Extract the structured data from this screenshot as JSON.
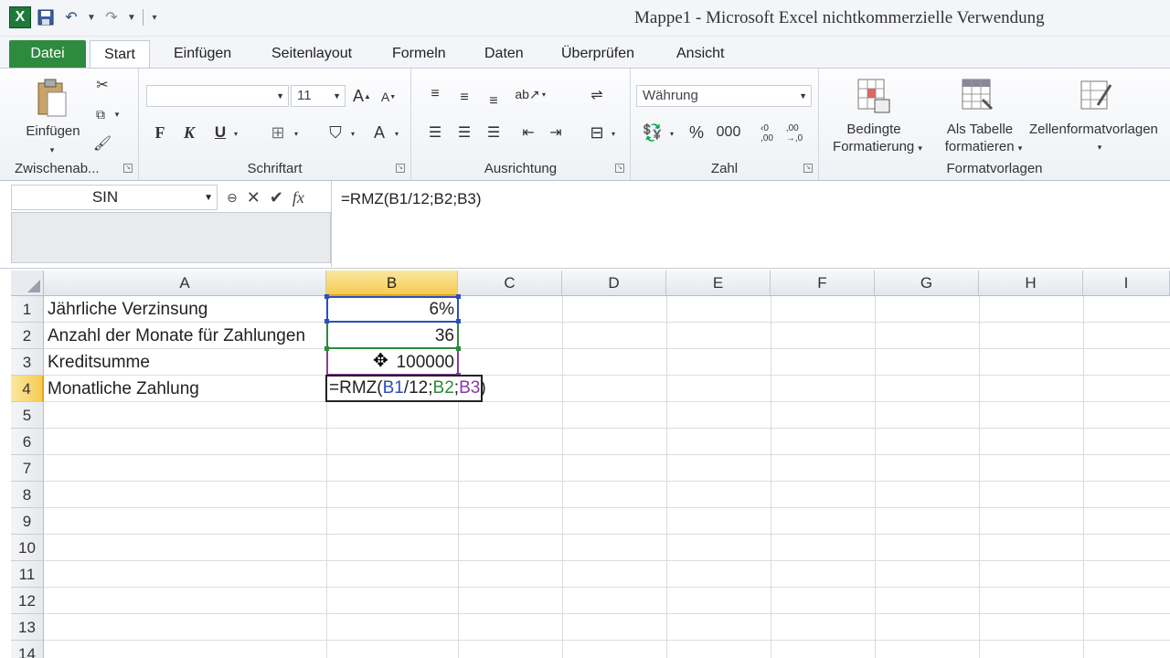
{
  "window": {
    "title": "Mappe1 - Microsoft Excel nichtkommerzielle Verwendung"
  },
  "qat": {
    "logo": "X"
  },
  "ribbon_tabs": [
    "Datei",
    "Start",
    "Einfügen",
    "Seitenlayout",
    "Formeln",
    "Daten",
    "Überprüfen",
    "Ansicht"
  ],
  "ribbon": {
    "clipboard": {
      "paste_label": "Einfügen",
      "group_label": "Zwischenab..."
    },
    "font": {
      "font_name": "",
      "font_size": "11",
      "bold": "F",
      "italic": "K",
      "underline": "U",
      "group_label": "Schriftart"
    },
    "alignment": {
      "group_label": "Ausrichtung"
    },
    "number": {
      "format": "Währung",
      "percent": "%",
      "thousands": "000",
      "inc_decimal": "‹0\n,00",
      "dec_decimal": ",00\n→,0",
      "group_label": "Zahl"
    },
    "styles": {
      "conditional_line1": "Bedingte",
      "conditional_line2": "Formatierung",
      "table_line1": "Als Tabelle",
      "table_line2": "formatieren",
      "cellstyles": "Zellenformatvorlagen",
      "group_label": "Formatvorlagen"
    }
  },
  "formula_bar": {
    "name_box": "SIN",
    "formula": "=RMZ(B1/12;B2;B3)"
  },
  "columns": [
    "A",
    "B",
    "C",
    "D",
    "E",
    "F",
    "G",
    "H",
    "I"
  ],
  "selected_column": "B",
  "rows": [
    "1",
    "2",
    "3",
    "4",
    "5",
    "6",
    "7",
    "8",
    "9",
    "10",
    "11",
    "12",
    "13",
    "14"
  ],
  "selected_row": "4",
  "cells": {
    "A1": "Jährliche Verzinsung",
    "A2": "Anzahl der Monate für Zahlungen",
    "A3": "Kreditsumme",
    "A4": "Monatliche Zahlung",
    "B1": "6%",
    "B2": "36",
    "B3": "100000"
  },
  "edit_cell": {
    "prefix": "=RMZ(",
    "ref1": "B1",
    "mid1": "/12;",
    "ref2": "B2",
    "sep": ";",
    "ref3": "B3",
    "suffix": ")"
  },
  "colors": {
    "ref_b1": "#2e4fb8",
    "ref_b2": "#2c8a3a",
    "ref_b3": "#8a3aa0",
    "datei_tab": "#2e8a3e",
    "selected_header": "#f5cb52"
  }
}
